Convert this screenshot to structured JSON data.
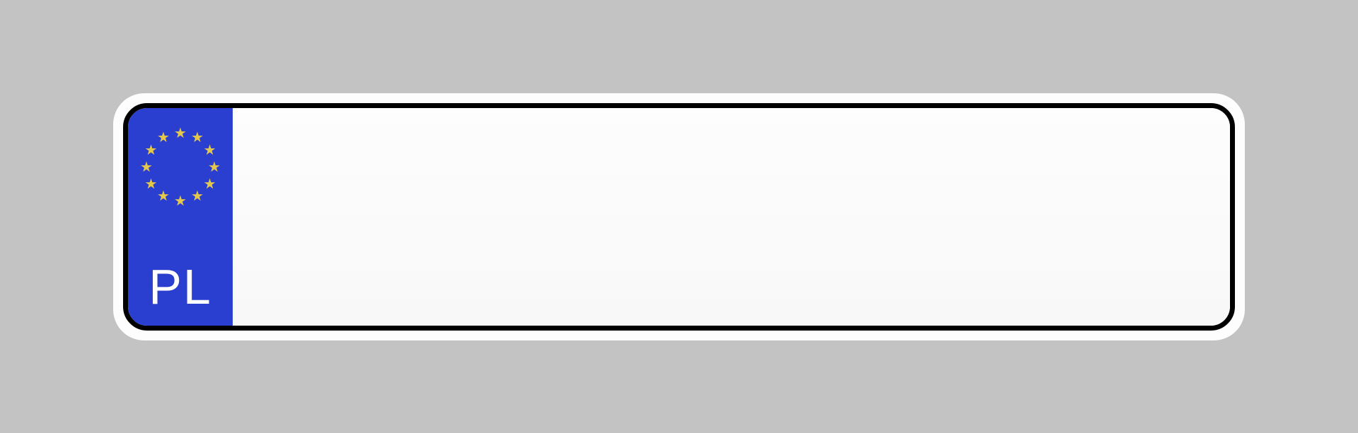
{
  "plate": {
    "country_code": "PL",
    "eu_star_count": 12,
    "colors": {
      "background": "#c3c3c3",
      "plate_face": "#fdfdfd",
      "border": "#000000",
      "eu_band": "#2a3fd0",
      "star": "#e5c84a",
      "country_text": "#ffffff"
    }
  }
}
